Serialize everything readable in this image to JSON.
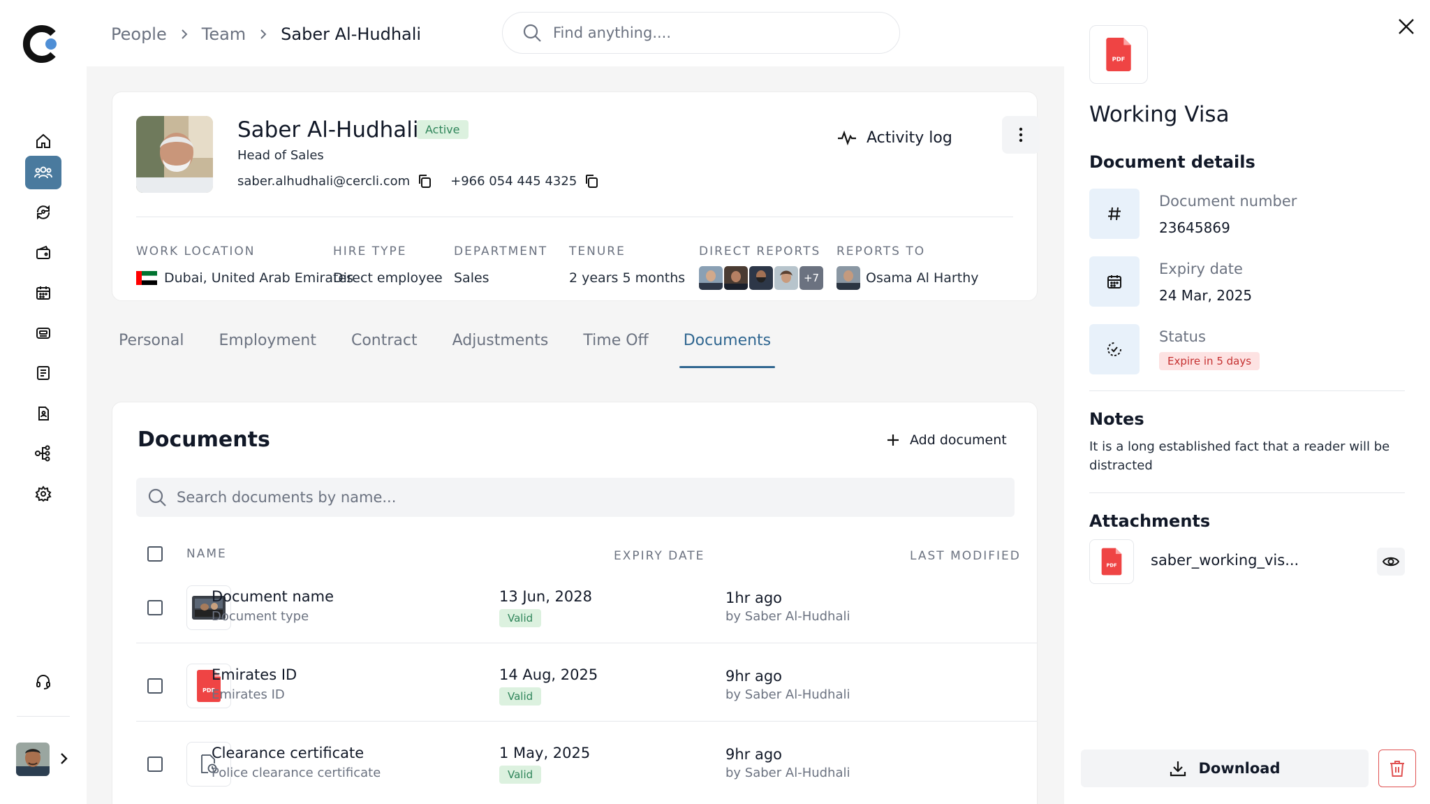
{
  "breadcrumb": [
    "People",
    "Team",
    "Saber Al-Hudhali"
  ],
  "search": {
    "placeholder": "Find anything...."
  },
  "sidebar": {
    "items": [
      {
        "icon": "home-icon"
      },
      {
        "icon": "people-icon",
        "active": true
      },
      {
        "icon": "sync-user-icon"
      },
      {
        "icon": "wallet-icon"
      },
      {
        "icon": "calendar-icon"
      },
      {
        "icon": "id-card-icon"
      },
      {
        "icon": "checklist-icon"
      },
      {
        "icon": "document-user-icon"
      },
      {
        "icon": "org-chart-icon"
      },
      {
        "icon": "settings-icon"
      }
    ],
    "support_icon": "headset-icon"
  },
  "profile": {
    "name": "Saber Al-Hudhali",
    "status": "Active",
    "role": "Head of Sales",
    "email": "saber.alhudhali@cercli.com",
    "phone": "+966 054 445 4325",
    "activity_log": "Activity log",
    "fields": {
      "work_location": {
        "label": "WORK LOCATION",
        "value": "Dubai, United Arab Emirates"
      },
      "hire_type": {
        "label": "HIRE TYPE",
        "value": "Direct employee"
      },
      "department": {
        "label": "DEPARTMENT",
        "value": "Sales"
      },
      "tenure": {
        "label": "TENURE",
        "value": "2 years 5 months"
      },
      "direct_reports": {
        "label": "DIRECT REPORTS",
        "more": "+7"
      },
      "reports_to": {
        "label": "REPORTS TO",
        "value": "Osama Al Harthy"
      }
    }
  },
  "tabs": [
    {
      "label": "Personal"
    },
    {
      "label": "Employment"
    },
    {
      "label": "Contract"
    },
    {
      "label": "Adjustments"
    },
    {
      "label": "Time Off"
    },
    {
      "label": "Documents",
      "active": true
    }
  ],
  "documents": {
    "title": "Documents",
    "add_label": "Add document",
    "search_placeholder": "Search documents by name...",
    "columns": {
      "name": "NAME",
      "expiry": "EXPIRY DATE",
      "modified": "LAST MODIFIED"
    },
    "rows": [
      {
        "name": "Document name",
        "type": "Document type",
        "expiry": "13 Jun, 2028",
        "status": "Valid",
        "modified": "1hr ago",
        "by": "by Saber Al-Hudhali",
        "thumb": "photo"
      },
      {
        "name": "Emirates ID",
        "type": "Emirates ID",
        "expiry": "14 Aug, 2025",
        "status": "Valid",
        "modified": "9hr ago",
        "by": "by Saber Al-Hudhali",
        "thumb": "pdf"
      },
      {
        "name": "Clearance certificate",
        "type": "Police clearance certificate",
        "expiry": "1 May, 2025",
        "status": "Valid",
        "modified": "9hr ago",
        "by": "by Saber Al-Hudhali",
        "thumb": "file"
      }
    ]
  },
  "panel": {
    "title": "Working Visa",
    "details_title": "Document details",
    "doc_number_label": "Document number",
    "doc_number": "23645869",
    "expiry_label": "Expiry date",
    "expiry": "24 Mar, 2025",
    "status_label": "Status",
    "status": "Expire in 5 days",
    "notes_title": "Notes",
    "notes": "It is a long established fact that a reader will be distracted",
    "attachments_title": "Attachments",
    "attachment_name": "saber_working_vis...",
    "download_label": "Download",
    "pdf_badge": "PDF"
  },
  "colors": {
    "accent": "#2f6690",
    "active_nav": "#4a7a9e",
    "valid_bg": "#dcf1df",
    "valid_fg": "#2f855a",
    "warn_bg": "#fde2e2",
    "warn_fg": "#c53030",
    "pdf_red": "#ef4444"
  }
}
